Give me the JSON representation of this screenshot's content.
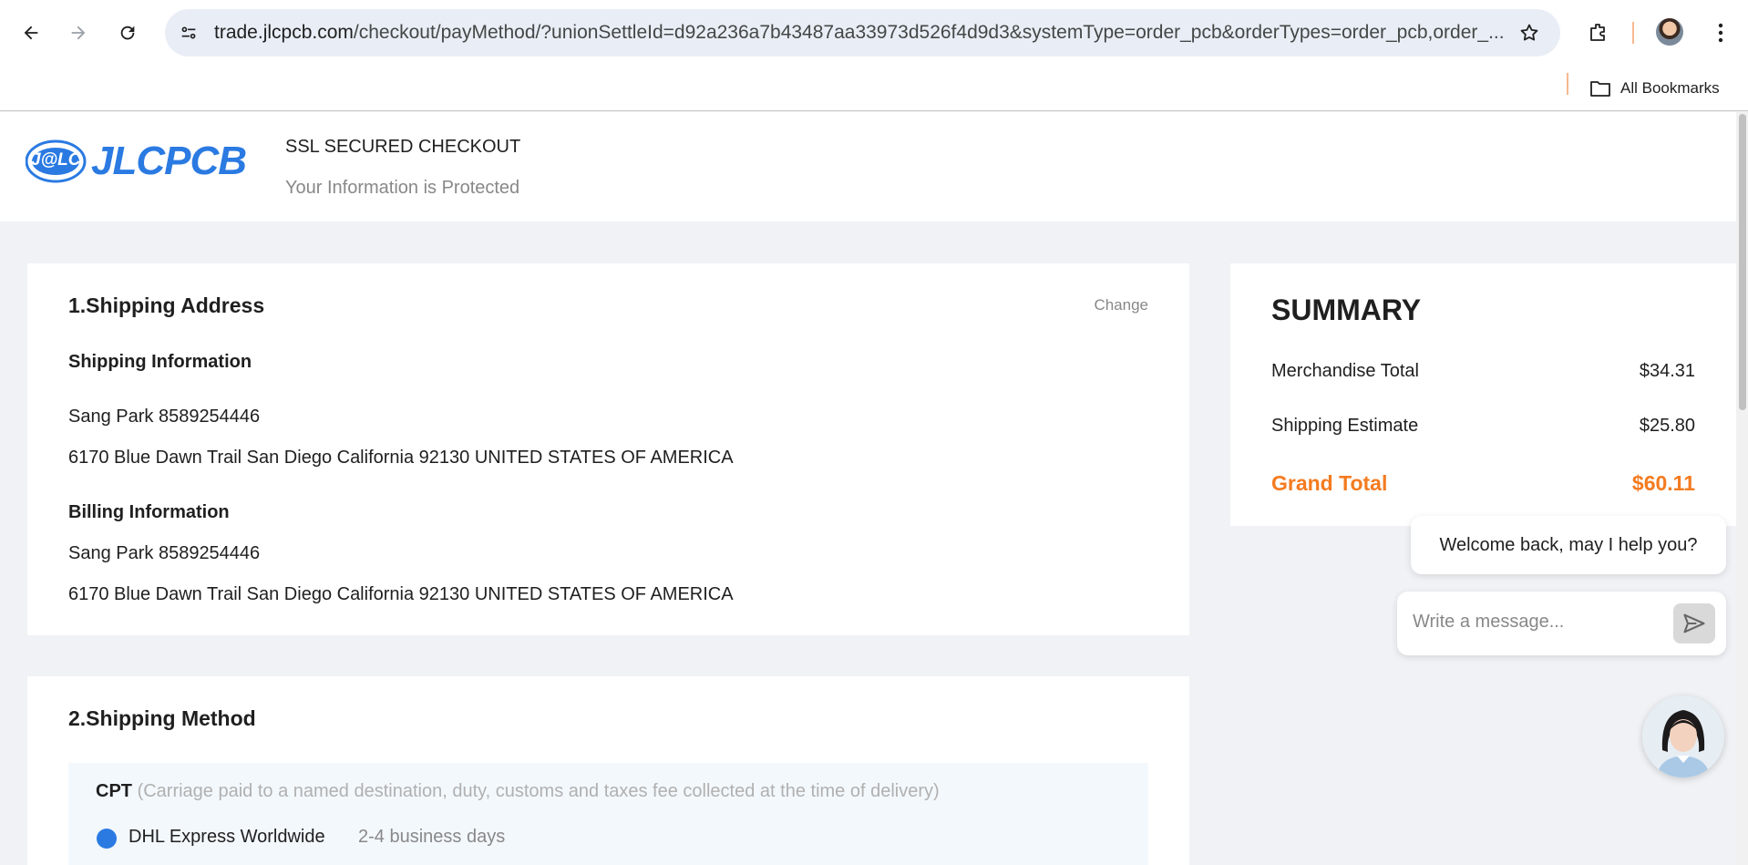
{
  "browser": {
    "url_host": "trade.jlcpcb.com",
    "url_rest": "/checkout/payMethod/?unionSettleId=d92a236a7b43487aa33973d526f4d9d3&systemType=order_pcb&orderTypes=order_pcb,order_...",
    "bookmarks_label": "All Bookmarks",
    "icons": [
      "back-icon",
      "forward-icon",
      "reload-icon",
      "site-info-icon",
      "star-icon",
      "extensions-icon",
      "profile-avatar",
      "menu-icon",
      "folder-icon"
    ]
  },
  "header": {
    "logo_mark": "J@LC",
    "logo_text": "JLCPCB",
    "ssl_title": "SSL SECURED CHECKOUT",
    "ssl_subtitle": "Your Information is Protected",
    "brand_color": "#2a7ae2"
  },
  "shipping_address": {
    "title": "1.Shipping Address",
    "change_label": "Change",
    "shipping_info_title": "Shipping Information",
    "shipping_name_phone": "Sang Park 8589254446",
    "shipping_address": "6170 Blue Dawn Trail San Diego California 92130 UNITED STATES OF AMERICA",
    "billing_info_title": "Billing Information",
    "billing_name_phone": "Sang Park 8589254446",
    "billing_address": "6170 Blue Dawn Trail San Diego California 92130 UNITED STATES OF AMERICA"
  },
  "shipping_method": {
    "title": "2.Shipping Method",
    "cpt_label": "CPT",
    "cpt_description": "(Carriage paid to a named destination, duty, customs and taxes fee collected at the time of delivery)",
    "carrier": "DHL Express Worldwide",
    "carrier_days": "2-4 business days",
    "selected": true
  },
  "summary": {
    "title": "SUMMARY",
    "merchandise_label": "Merchandise Total",
    "merchandise_value": "$34.31",
    "shipping_label": "Shipping Estimate",
    "shipping_value": "$25.80",
    "grand_label": "Grand Total",
    "grand_value": "$60.11",
    "grand_color": "#f47b20"
  },
  "chat": {
    "greeting": "Welcome back, may I help you?",
    "placeholder": "Write a message...",
    "icons": [
      "send-icon",
      "agent-avatar"
    ]
  }
}
